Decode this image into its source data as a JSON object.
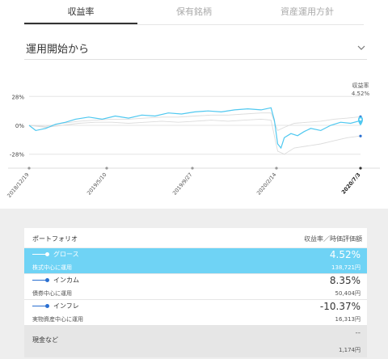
{
  "tabs": [
    {
      "label": "収益率",
      "active": true
    },
    {
      "label": "保有銘柄",
      "active": false
    },
    {
      "label": "資産運用方針",
      "active": false
    }
  ],
  "period_select": {
    "label": "運用開始から"
  },
  "chart_data": {
    "type": "line",
    "y_ticks": [
      "28%",
      "0%",
      "-28%"
    ],
    "ylim": [
      -40,
      40
    ],
    "x_labels": [
      "2018/12/19",
      "2019/5/10",
      "2019/9/27",
      "2020/2/14",
      "2020/7/3"
    ],
    "current_label": "収益率",
    "current_value": "4.52%",
    "series": [
      {
        "name": "グロース",
        "color": "#4fc8f0",
        "points": [
          [
            0,
            0
          ],
          [
            2,
            -5
          ],
          [
            5,
            -3
          ],
          [
            8,
            1
          ],
          [
            11,
            3
          ],
          [
            14,
            6
          ],
          [
            18,
            8
          ],
          [
            22,
            6
          ],
          [
            26,
            9
          ],
          [
            30,
            7
          ],
          [
            34,
            10
          ],
          [
            38,
            9
          ],
          [
            42,
            12
          ],
          [
            46,
            11
          ],
          [
            50,
            13
          ],
          [
            54,
            14
          ],
          [
            58,
            13
          ],
          [
            62,
            15
          ],
          [
            66,
            16
          ],
          [
            70,
            15
          ],
          [
            73,
            17
          ],
          [
            74,
            5
          ],
          [
            75,
            -18
          ],
          [
            76,
            -22
          ],
          [
            77,
            -12
          ],
          [
            79,
            -8
          ],
          [
            81,
            -10
          ],
          [
            83,
            -6
          ],
          [
            85,
            -3
          ],
          [
            88,
            -5
          ],
          [
            91,
            0
          ],
          [
            94,
            3
          ],
          [
            97,
            2
          ],
          [
            100,
            4.52
          ]
        ]
      },
      {
        "name": "インカム",
        "color": "#dcdcdc",
        "points": [
          [
            0,
            0
          ],
          [
            5,
            -1
          ],
          [
            10,
            2
          ],
          [
            15,
            4
          ],
          [
            20,
            5
          ],
          [
            25,
            6
          ],
          [
            30,
            6
          ],
          [
            35,
            7
          ],
          [
            40,
            8
          ],
          [
            45,
            8
          ],
          [
            50,
            9
          ],
          [
            55,
            10
          ],
          [
            60,
            10
          ],
          [
            65,
            11
          ],
          [
            70,
            12
          ],
          [
            73,
            12
          ],
          [
            75,
            -5
          ],
          [
            77,
            -2
          ],
          [
            80,
            2
          ],
          [
            84,
            3
          ],
          [
            88,
            4
          ],
          [
            92,
            6
          ],
          [
            96,
            7
          ],
          [
            100,
            8.35
          ]
        ]
      },
      {
        "name": "インフレ",
        "color": "#dcdcdc",
        "points": [
          [
            0,
            0
          ],
          [
            5,
            -2
          ],
          [
            10,
            0
          ],
          [
            15,
            2
          ],
          [
            20,
            3
          ],
          [
            25,
            3
          ],
          [
            30,
            2
          ],
          [
            35,
            3
          ],
          [
            40,
            4
          ],
          [
            45,
            3
          ],
          [
            50,
            4
          ],
          [
            55,
            5
          ],
          [
            60,
            4
          ],
          [
            65,
            5
          ],
          [
            70,
            6
          ],
          [
            73,
            5
          ],
          [
            75,
            -25
          ],
          [
            77,
            -28
          ],
          [
            80,
            -22
          ],
          [
            84,
            -20
          ],
          [
            88,
            -18
          ],
          [
            92,
            -15
          ],
          [
            96,
            -12
          ],
          [
            100,
            -10.37
          ]
        ]
      }
    ],
    "colors": {
      "accent": "#4fc8f0",
      "axis_dot": "#555555",
      "grid": "#e5e5e5"
    }
  },
  "portfolio": {
    "header_left": "ポートフォリオ",
    "header_right": "収益率／時価評価額",
    "rows": [
      {
        "name": "グロース",
        "sub": "株式中心に運用",
        "rate": "4.52%",
        "amount": "138,721円",
        "selected": true
      },
      {
        "name": "インカム",
        "sub": "債券中心に運用",
        "rate": "8.35%",
        "amount": "50,404円",
        "selected": false
      },
      {
        "name": "インフレ",
        "sub": "実物資産中心に運用",
        "rate": "-10.37%",
        "amount": "16,313円",
        "selected": false
      }
    ],
    "cash": {
      "name": "現金など",
      "rate": "--",
      "amount": "1,174円"
    }
  }
}
